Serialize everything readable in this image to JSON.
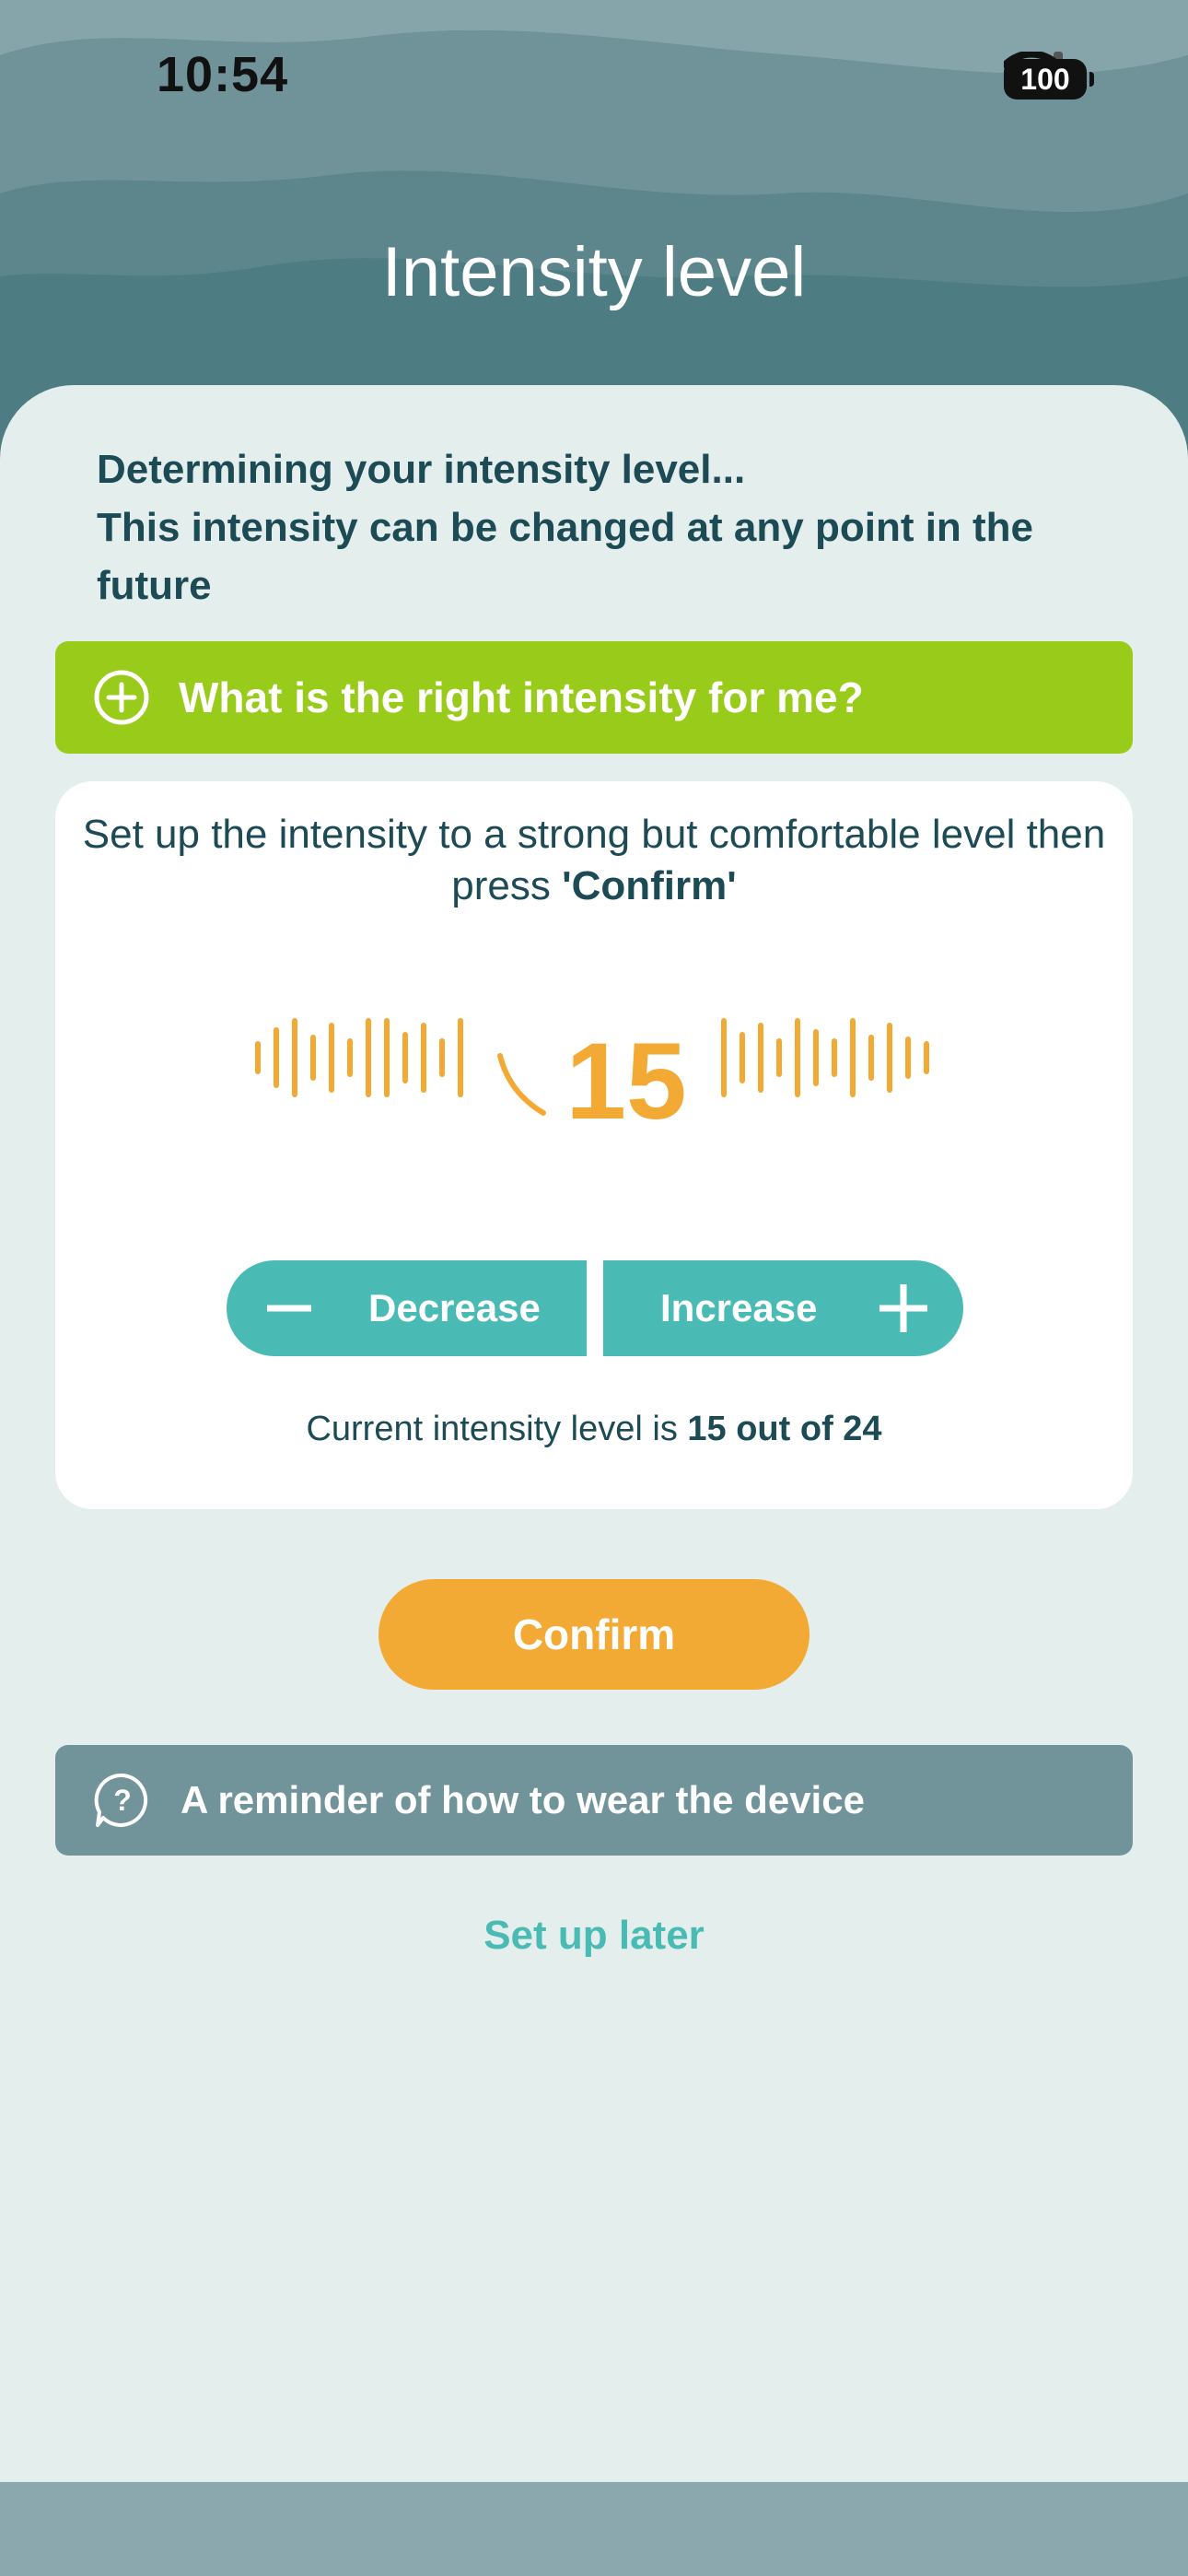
{
  "status_bar": {
    "time": "10:54",
    "battery": "100"
  },
  "header": {
    "title": "Intensity level"
  },
  "intro": {
    "line1": "Determining your intensity level...",
    "line2": "This intensity can be changed at any point in the future"
  },
  "help_accordion": {
    "label": "What is the right intensity for me?",
    "icon": "plus-circle-icon"
  },
  "card": {
    "instruction_prefix": "Set up the intensity to a strong but comfortable level then press ",
    "instruction_emphasis": "'Confirm'",
    "level_value": "15",
    "decrease_label": "Decrease",
    "increase_label": "Increase",
    "current_prefix": "Current intensity level is ",
    "current_value": "15 out of 24"
  },
  "intensity": {
    "current": 15,
    "max": 24
  },
  "confirm_label": "Confirm",
  "reminder_accordion": {
    "label": "A reminder of how to wear the device",
    "icon": "question-bubble-icon"
  },
  "setup_later_label": "Set up later",
  "colors": {
    "header": "#4d7c83",
    "accent_green": "#99cc1a",
    "teal": "#4abbb4",
    "orange": "#f3aa35",
    "grey_accordion": "#71949a",
    "text_dark": "#1c4a55",
    "background": "#e3eeed"
  }
}
